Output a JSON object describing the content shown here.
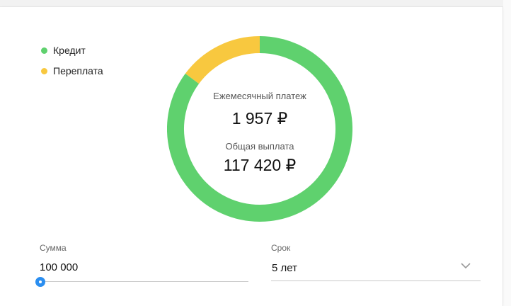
{
  "legend": {
    "items": [
      {
        "label": "Кредит",
        "color": "#5fd16e"
      },
      {
        "label": "Переплата",
        "color": "#f8c83f"
      }
    ]
  },
  "summary": {
    "monthly_label": "Ежемесячный платеж",
    "monthly_value": "1 957 ₽",
    "total_label": "Общая выплата",
    "total_value": "117 420 ₽"
  },
  "chart_data": {
    "type": "pie",
    "categories": [
      "Кредит",
      "Переплата"
    ],
    "values": [
      100000,
      17420
    ],
    "colors": [
      "#5fd16e",
      "#f8c83f"
    ]
  },
  "form": {
    "amount_label": "Сумма",
    "amount_value": "100 000",
    "amount_slider_fraction": 0,
    "term_label": "Срок",
    "term_value": "5 лет",
    "term_icon": "chevron-down-icon"
  },
  "colors": {
    "accent": "#2b8ef0",
    "credit": "#5fd16e",
    "overpay": "#f8c83f"
  }
}
